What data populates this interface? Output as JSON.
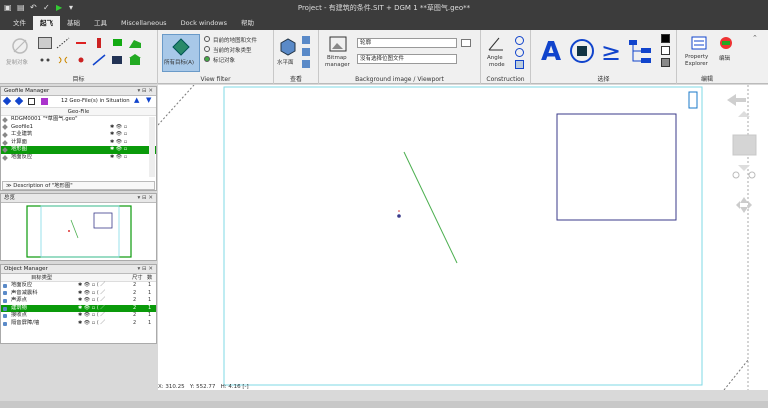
{
  "titlebar": {
    "title": "Project - 有建筑的条件.SIT + DGM 1 **草图气.geo**"
  },
  "menu": [
    "文件",
    "起飞",
    "基础",
    "工具",
    "Miscellaneous",
    "Dock windows",
    "帮助"
  ],
  "ribbon": {
    "ghost_btn": "复制对象",
    "group1_label": "目标",
    "viewfilter": {
      "big": "所有目标(A)",
      "opt1": "目前的地图和文件",
      "opt2": "当前的对象类型",
      "opt3": "标记对象",
      "label": "View filter"
    },
    "view": {
      "btn": "水平面",
      "label": "查看"
    },
    "bg": {
      "btn1": "Bitmap",
      "btn2": "manager",
      "combo1": "轮廓",
      "combo2": "没有选择位图文件",
      "label": "Background image / Viewport"
    },
    "construction": {
      "btn1": "Angle",
      "btn2": "mode",
      "label": "Construction"
    },
    "select": {
      "symbol": "≥",
      "label": "选择"
    },
    "edit": {
      "btn1": "Property",
      "btn2": "Explorer",
      "btn3": "编辑",
      "label": "编辑"
    }
  },
  "geofile": {
    "title": "Geofile Manager",
    "count": "12 Geo-File(s) in Situation",
    "col": "Geo-File",
    "rows": [
      "RDGM0001 \"*草图气.geo\"",
      "Geofile1",
      "工业建筑",
      "计算面",
      "地形图",
      "地面反应"
    ],
    "sel_index": 4,
    "desc": "Description of \"地形图\""
  },
  "overview": {
    "title": "总览"
  },
  "objmgr": {
    "title": "Object Manager",
    "col1": "目标类型",
    "col2": "尺寸",
    "col3": "数",
    "rows": [
      {
        "name": "地面反应",
        "size": "2",
        "count": "1"
      },
      {
        "name": "声音减震科",
        "size": "2",
        "count": "1"
      },
      {
        "name": "声源点",
        "size": "2",
        "count": "1"
      },
      {
        "name": "建筑物",
        "size": "2",
        "count": "1"
      },
      {
        "name": "接收点",
        "size": "2",
        "count": "1"
      },
      {
        "name": "隔音屏障/墙",
        "size": "2",
        "count": "1"
      }
    ],
    "sel_index": 3
  },
  "status": {
    "x": "X: 310.25",
    "y": "Y: 552.77",
    "h": "H: 4.16 [-]"
  },
  "colors": {
    "accent_green": "#0a9a0a",
    "line_green": "#4caf50",
    "square": "#3a3a8a",
    "cyan": "#7fd9e6"
  }
}
